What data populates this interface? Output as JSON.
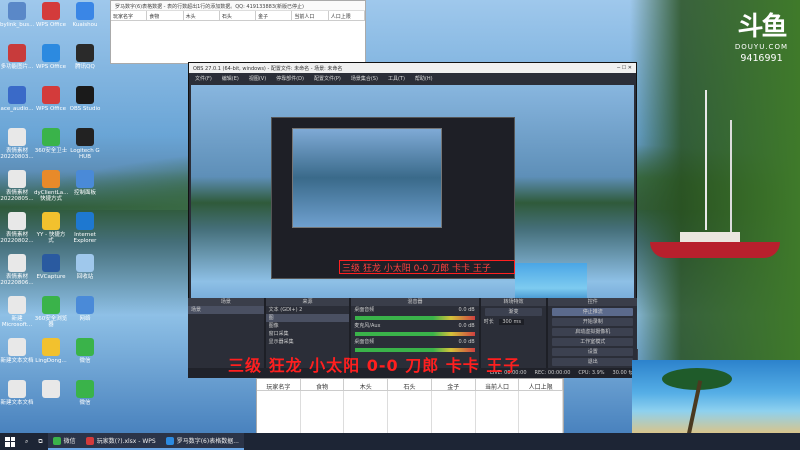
{
  "douyu": {
    "brand": "DOUYU.COM",
    "room_id": "9416991"
  },
  "desktop_icons": [
    {
      "label": "bylink_bus...",
      "color": "#5a88c8"
    },
    {
      "label": "WPS Office",
      "color": "#d33b3b"
    },
    {
      "label": "Kuaishou",
      "color": "#3a86e6"
    },
    {
      "label": "多功能图片...",
      "color": "#c83b3b"
    },
    {
      "label": "WPS Office",
      "color": "#2c8ae0"
    },
    {
      "label": "腾讯QQ",
      "color": "#2a2a2a"
    },
    {
      "label": "ace_audio...",
      "color": "#3a6ac8"
    },
    {
      "label": "WPS Office",
      "color": "#d33b3b"
    },
    {
      "label": "OBS Studio",
      "color": "#1a1a1a"
    },
    {
      "label": "表情素材 20220803...",
      "color": "#e8e8e8"
    },
    {
      "label": "360安全卫士",
      "color": "#3ab34a"
    },
    {
      "label": "Logitech G HUB",
      "color": "#222"
    },
    {
      "label": "表情素材 20220805...",
      "color": "#e8e8e8"
    },
    {
      "label": "dyClientLa... 快捷方式",
      "color": "#e88a2a"
    },
    {
      "label": "控制面板",
      "color": "#4a8ad8"
    },
    {
      "label": "表情素材 20220802...",
      "color": "#e8e8e8"
    },
    {
      "label": "YY - 快捷方式",
      "color": "#f2c12e"
    },
    {
      "label": "Internet Explorer",
      "color": "#1e78d0"
    },
    {
      "label": "表情素材 20220806...",
      "color": "#e8e8e8"
    },
    {
      "label": "EVCapture",
      "color": "#2a5aa0"
    },
    {
      "label": "回收站",
      "color": "#9fc8ec"
    },
    {
      "label": "新建 Microsoft...",
      "color": "#e8e8e8"
    },
    {
      "label": "360安全浏览器",
      "color": "#3ab34a"
    },
    {
      "label": "网络",
      "color": "#4a8ad8"
    },
    {
      "label": "新建文本文档",
      "color": "#e8e8e8"
    },
    {
      "label": "LingDong...",
      "color": "#f2c12e"
    },
    {
      "label": "微信",
      "color": "#3ab34a"
    },
    {
      "label": "新建文本文档",
      "color": "#e8e8e8"
    },
    {
      "label": "",
      "color": "#e8e8e8"
    },
    {
      "label": "微信",
      "color": "#3ab34a"
    }
  ],
  "grid_top": {
    "title": "罗马数字(6)表格数据 - 表的行数超出1行的添加数据。QQ: 419133883(新版已停止)",
    "headers": [
      "玩家名字",
      "食物",
      "木头",
      "石头",
      "金子",
      "当前人口",
      "人口上限"
    ]
  },
  "obs": {
    "title": "OBS 27.0.1 (64-bit, windows) - 配置文件: 未命名 - 场景: 未命名",
    "menu": [
      "文件(F)",
      "编辑(E)",
      "视图(V)",
      "停靠部件(D)",
      "配置文件(P)",
      "场景集合(S)",
      "工具(T)",
      "帮助(H)"
    ],
    "scene_bar": [
      "属性",
      "滤镜",
      "选择显示器",
      "选择区域"
    ],
    "hud": "三级 狂龙 小太阳 0-0 刀郎 卡卡 王子",
    "docks": {
      "scenes": {
        "title": "场景",
        "items": [
          "场景"
        ]
      },
      "sources": {
        "title": "来源",
        "items": [
          "文本 (GDI+) 2",
          "图",
          "图像",
          "窗口采集",
          "显示器采集"
        ]
      },
      "mixer": {
        "title": "混音器",
        "channels": [
          {
            "name": "桌面音频",
            "db": "0.0 dB"
          },
          {
            "name": "麦克风/Aux",
            "db": "0.0 dB"
          },
          {
            "name": "桌面音频",
            "db": "0.0 dB"
          }
        ]
      },
      "transitions": {
        "title": "转场特效",
        "type": "渐变",
        "duration_label": "时长",
        "duration_value": "300 ms"
      },
      "controls": {
        "title": "控件",
        "buttons": [
          "停止推流",
          "开始录制",
          "启动虚拟摄像机",
          "工作室模式",
          "设置",
          "退出"
        ]
      }
    }
  },
  "danmaku": "三级 狂龙 小太阳 0-0 刀郎 卡卡 王子",
  "status_strip": [
    "LIVE: 00:00:00",
    "REC: 00:00:00",
    "CPU: 3.9%",
    "30.00 fps"
  ],
  "grid_lower": {
    "headers": [
      "玩家名字",
      "食物",
      "木头",
      "石头",
      "金子",
      "当前人口",
      "人口上限"
    ]
  },
  "taskbar": {
    "items": [
      "微信",
      "玩家数(?).xlsx - WPS",
      "罗马数字(6)表格数据..."
    ]
  }
}
